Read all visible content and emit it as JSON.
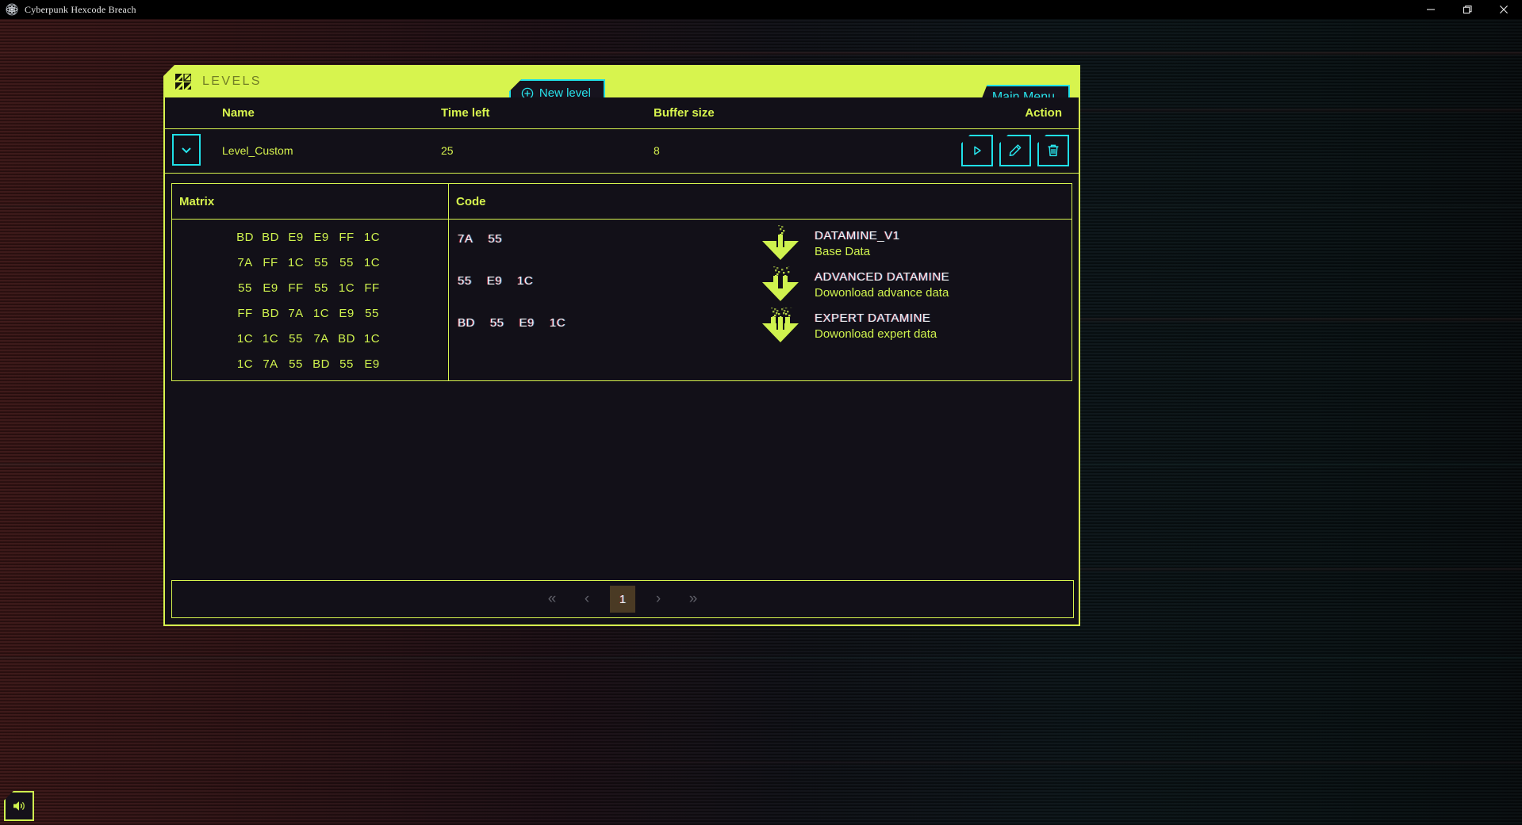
{
  "window": {
    "title": "Cyberpunk Hexcode Breach",
    "icon": "app-atom-icon",
    "controls": {
      "minimize": "minimize-icon",
      "maximize": "maximize-icon",
      "close": "close-icon"
    }
  },
  "theme": {
    "lime": "#d7f44e",
    "cyan": "#1fe0e8",
    "panel_bg": "#121018",
    "white": "#f2f2f2",
    "page_active_bg": "#4a3a24"
  },
  "panel": {
    "title": "LEVELS",
    "glyph": "matrix-glyph-icon",
    "new_level_label": "New level",
    "main_menu_label": "Main Menu"
  },
  "table": {
    "columns": [
      "Name",
      "Time left",
      "Buffer size",
      "Action"
    ],
    "rows": [
      {
        "name": "Level_Custom",
        "time_left": "25",
        "buffer_size": "8",
        "expanded": true,
        "actions": [
          "play-button",
          "edit-button",
          "delete-button"
        ]
      }
    ]
  },
  "detail": {
    "matrix_label": "Matrix",
    "code_label": "Code",
    "matrix": [
      [
        "BD",
        "BD",
        "E9",
        "E9",
        "FF",
        "1C"
      ],
      [
        "7A",
        "FF",
        "1C",
        "55",
        "55",
        "1C"
      ],
      [
        "55",
        "E9",
        "FF",
        "55",
        "1C",
        "FF"
      ],
      [
        "FF",
        "BD",
        "7A",
        "1C",
        "E9",
        "55"
      ],
      [
        "1C",
        "1C",
        "55",
        "7A",
        "BD",
        "1C"
      ],
      [
        "1C",
        "7A",
        "55",
        "BD",
        "55",
        "E9"
      ]
    ],
    "codes": [
      [
        "7A",
        "55"
      ],
      [
        "55",
        "E9",
        "1C"
      ],
      [
        "BD",
        "55",
        "E9",
        "1C"
      ]
    ],
    "datamines": [
      {
        "title": "DATAMINE_V1",
        "subtitle": "Base Data",
        "icon": "datamine-v1-icon"
      },
      {
        "title": "ADVANCED DATAMINE",
        "subtitle": "Dowonload advance data",
        "icon": "datamine-v2-icon"
      },
      {
        "title": "EXPERT DATAMINE",
        "subtitle": "Dowonload expert data",
        "icon": "datamine-v3-icon"
      }
    ]
  },
  "pagination": {
    "first": "«",
    "prev": "‹",
    "current": "1",
    "next": "›",
    "last": "»"
  },
  "sound": {
    "icon": "speaker-on-icon"
  }
}
